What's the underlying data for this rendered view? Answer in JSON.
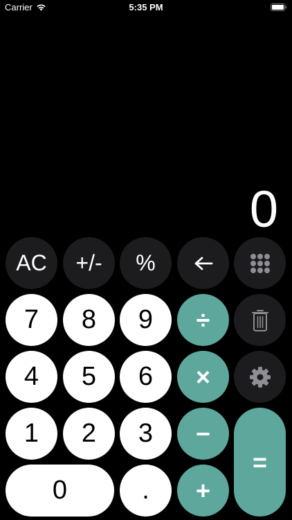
{
  "status_bar": {
    "carrier": "Carrier",
    "time": "5:35 PM",
    "wifi_icon": "wifi-icon",
    "battery_icon": "battery-icon"
  },
  "display": {
    "value": "0"
  },
  "keys": {
    "ac": "AC",
    "plus_minus": "+/-",
    "percent": "%",
    "backspace_icon": "left-arrow-icon",
    "keypad_icon": "grid-dots-icon",
    "seven": "7",
    "eight": "8",
    "nine": "9",
    "divide": "÷",
    "trash_icon": "trash-icon",
    "four": "4",
    "five": "5",
    "six": "6",
    "multiply": "×",
    "settings_icon": "gear-icon",
    "one": "1",
    "two": "2",
    "three": "3",
    "minus": "−",
    "equals": "=",
    "zero": "0",
    "decimal": ".",
    "plus": "+"
  },
  "colors": {
    "background": "#000000",
    "dark_key": "#1c1c1e",
    "light_key": "#ffffff",
    "accent": "#5ea79c"
  }
}
